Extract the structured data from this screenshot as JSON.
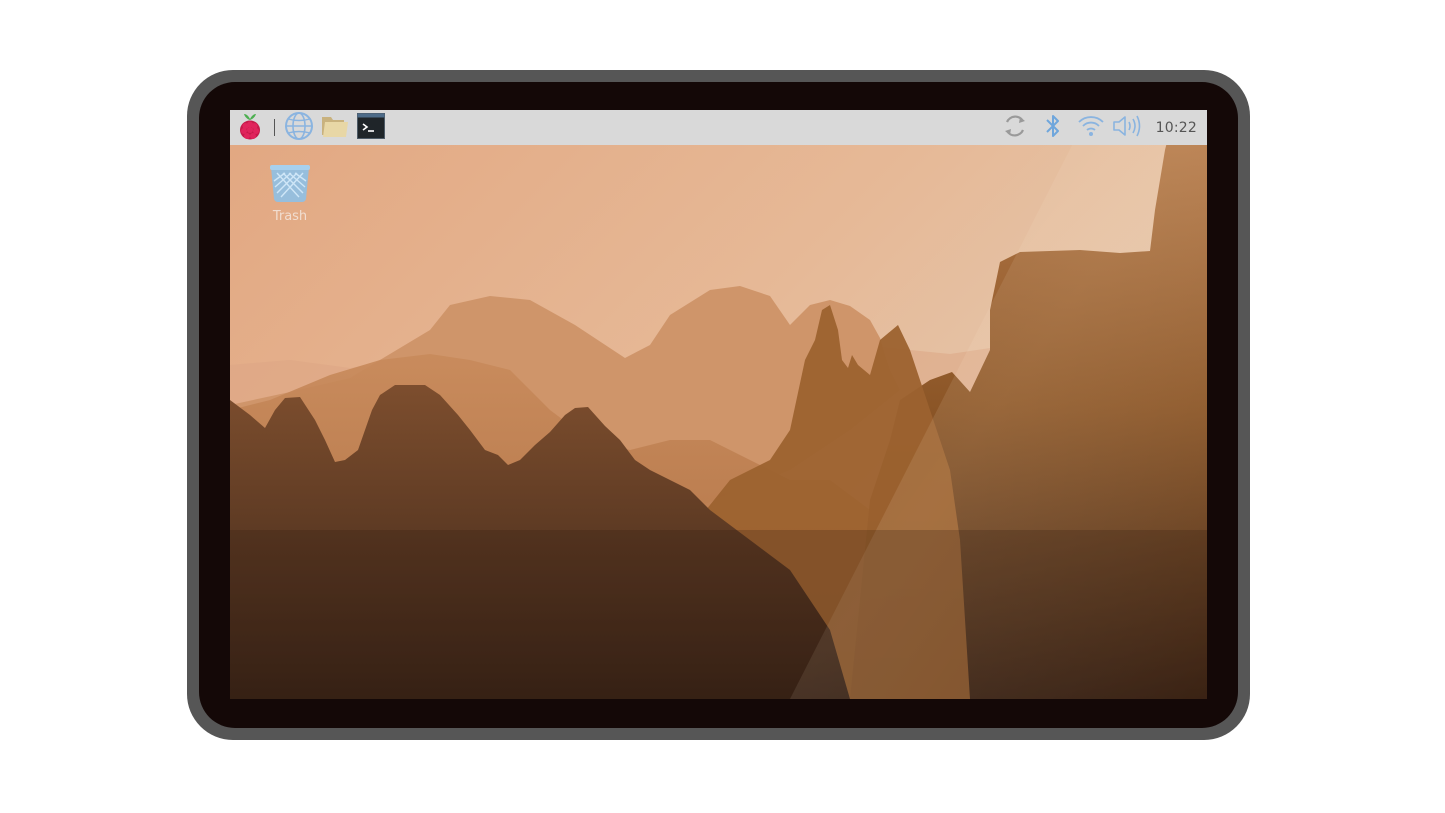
{
  "taskbar": {
    "menu_icon": "raspberry-pi-logo",
    "launchers": [
      {
        "name": "web-browser",
        "icon": "globe-icon"
      },
      {
        "name": "file-manager",
        "icon": "folder-icon"
      },
      {
        "name": "terminal",
        "icon": "terminal-icon"
      }
    ],
    "tray": [
      {
        "name": "updates",
        "icon": "sync-icon"
      },
      {
        "name": "bluetooth",
        "icon": "bluetooth-icon"
      },
      {
        "name": "wifi",
        "icon": "wifi-icon"
      },
      {
        "name": "volume",
        "icon": "volume-icon"
      }
    ],
    "clock": "10:22"
  },
  "desktop": {
    "icons": [
      {
        "label": "Trash",
        "icon": "trash-icon"
      }
    ]
  },
  "colors": {
    "taskbar_bg": "#d9d9d9",
    "tray_icon": "#8ab4e0",
    "bezel": "#140807",
    "frame": "#565656",
    "sky": "#e0b08e"
  }
}
